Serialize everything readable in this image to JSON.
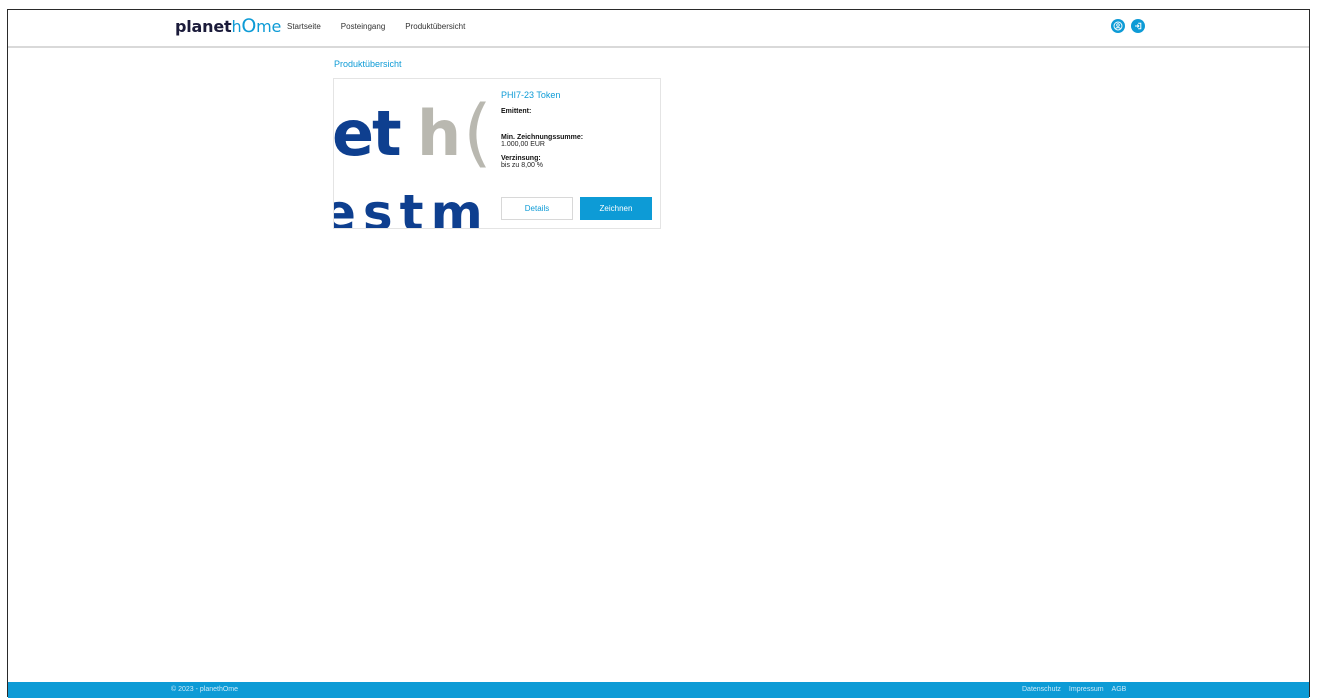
{
  "header": {
    "logo": {
      "part1": "planet",
      "part2": "h",
      "part3": "O",
      "part4": "me"
    },
    "nav": [
      "Startseite",
      "Posteingang",
      "Produktübersicht"
    ],
    "icons": [
      "user-icon",
      "logout-icon"
    ]
  },
  "main": {
    "title": "Produktübersicht",
    "product": {
      "image": {
        "line1": [
          "e",
          "t",
          "h",
          "("
        ],
        "line2": "estm"
      },
      "name": "PHI7-23 Token",
      "emittent_label": "Emittent:",
      "emittent_value": "",
      "min_label": "Min. Zeichnungssumme:",
      "min_value": "1.000,00 EUR",
      "rate_label": "Verzinsung:",
      "rate_value": "bis zu 8,00 %",
      "details_label": "Details",
      "subscribe_label": "Zeichnen"
    }
  },
  "footer": {
    "copyright": "© 2023 - planethOme",
    "links": [
      "Datenschutz",
      "Impressum",
      "AGB"
    ]
  },
  "colors": {
    "accent": "#0d9bd6",
    "logo_dark": "#1b1b3a",
    "image_blue": "#0e3f8f",
    "image_grey": "#b9b8b0"
  }
}
